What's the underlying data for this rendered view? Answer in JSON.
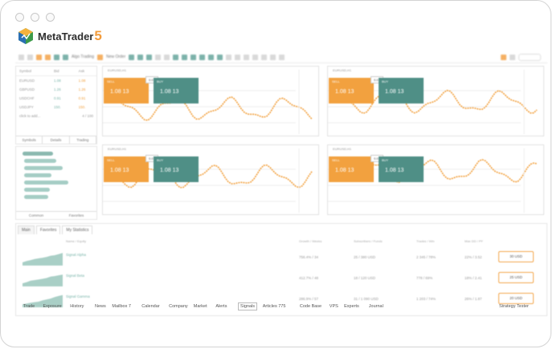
{
  "app": {
    "brand_name": "MetaTrader",
    "brand_version": "5"
  },
  "toolbar": {
    "algo_trading_label": "Algo Trading",
    "new_order_label": "New Order"
  },
  "market_watch": {
    "columns": [
      "Symbol",
      "Bid",
      "Ask"
    ],
    "rows": [
      {
        "symbol": "EURUSD",
        "bid": "1.08",
        "ask": "1.08"
      },
      {
        "symbol": "GBPUSD",
        "bid": "1.26",
        "ask": "1.26"
      },
      {
        "symbol": "USDCHF",
        "bid": "0.91",
        "ask": "0.91"
      },
      {
        "symbol": "USDJPY",
        "bid": "150.",
        "ask": "150."
      }
    ],
    "add_row": "click to add...",
    "add_row_count": "4 / 100",
    "tabs": [
      "Symbols",
      "Details",
      "Trading"
    ]
  },
  "navigator": {
    "tabs": [
      "Common",
      "Favorites"
    ]
  },
  "charts": [
    {
      "title": "EURUSD,H1",
      "sell_label": "SELL",
      "buy_label": "BUY",
      "volume": "0.01",
      "sell_price": "1.08 13",
      "buy_price": "1.08 13"
    },
    {
      "title": "EURUSD,H1",
      "sell_label": "SELL",
      "buy_label": "BUY",
      "volume": "0.01",
      "sell_price": "1.08 13",
      "buy_price": "1.08 13"
    },
    {
      "title": "EURUSD,H1",
      "sell_label": "SELL",
      "buy_label": "BUY",
      "volume": "0.01",
      "sell_price": "1.08 13",
      "buy_price": "1.08 13"
    },
    {
      "title": "EURUSD,H1",
      "sell_label": "SELL",
      "buy_label": "BUY",
      "volume": "0.01",
      "sell_price": "1.08 13",
      "buy_price": "1.08 13"
    }
  ],
  "signals": {
    "tabs": [
      "Main",
      "Favorites",
      "My Statistics"
    ],
    "columns": [
      "Name / Equity",
      "Growth / Weeks",
      "Subscribers / Funds",
      "Trades / Win",
      "Max DD / PF"
    ],
    "rows": [
      {
        "name": "Signal Alpha",
        "growth": "756.4% / 34",
        "subscribers": "25 / 380 USD",
        "trades": "2 345 / 78%",
        "dd": "22% / 3.52",
        "price": "30 USD"
      },
      {
        "name": "Signal Beta",
        "growth": "412.7% / 48",
        "subscribers": "18 / 120 USD",
        "trades": "778 / 69%",
        "dd": "18% / 2.41",
        "price": "25 USD"
      },
      {
        "name": "Signal Gamma",
        "growth": "286.9% / 57",
        "subscribers": "31 / 1 090 USD",
        "trades": "1 203 / 74%",
        "dd": "26% / 1.87",
        "price": "20 USD"
      }
    ]
  },
  "bottom_tabs": [
    "Trade",
    "Exposure",
    "History",
    "News",
    "Mailbox 7",
    "Calendar",
    "Company",
    "Market",
    "Alerts",
    "Signals",
    "Articles 775",
    "Code Base",
    "VPS",
    "Experts",
    "Journal"
  ],
  "active_bottom_tab": "Signals",
  "strategy_tester_label": "Strategy Tester",
  "colors": {
    "accent_orange": "#f2a13f",
    "accent_teal": "#4f8f86",
    "bull_line": "#f2a13f"
  }
}
